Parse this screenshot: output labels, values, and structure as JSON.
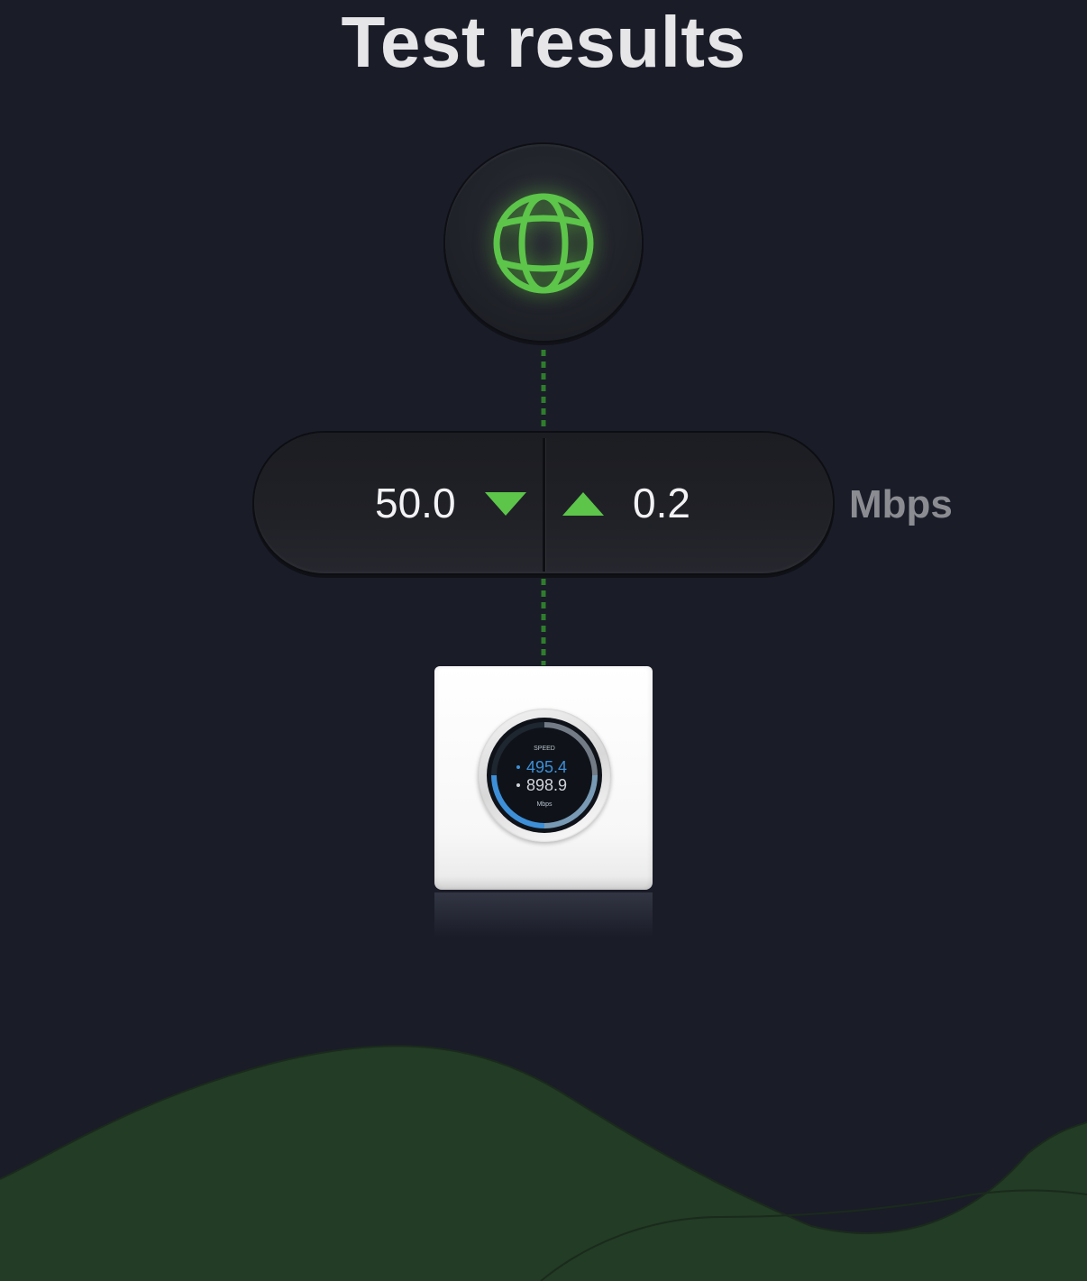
{
  "header": {
    "title": "Test results"
  },
  "internet": {
    "icon": "globe-icon",
    "icon_color": "#5cc54a"
  },
  "speed": {
    "download_value": "50.0",
    "upload_value": "0.2",
    "unit": "Mbps",
    "download_icon": "triangle-down-icon",
    "upload_icon": "triangle-up-icon",
    "accent_color": "#5cc54a"
  },
  "router": {
    "display_label": "SPEED",
    "display_value_1": "495.4",
    "display_value_2": "898.9",
    "display_unit": "Mbps"
  },
  "colors": {
    "background": "#1a1c28",
    "hills": "#233c25"
  }
}
